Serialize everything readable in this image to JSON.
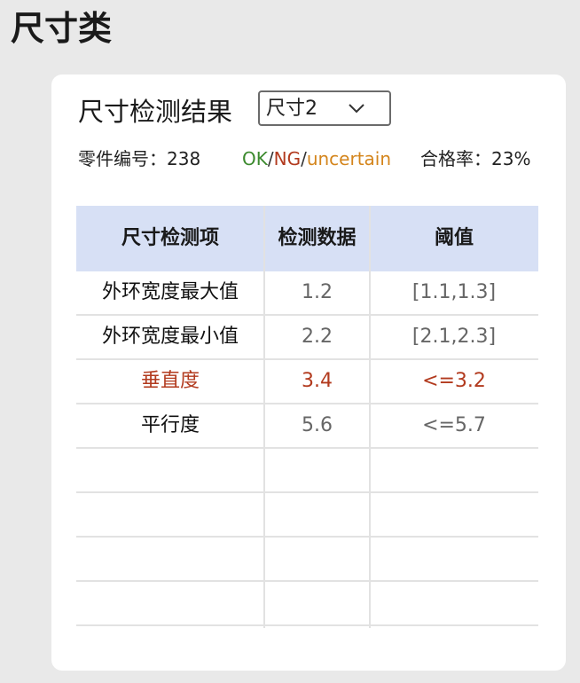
{
  "page": {
    "title": "尺寸类"
  },
  "card": {
    "title": "尺寸检测结果",
    "select": {
      "value": "尺寸2",
      "icon": "chevron-down-icon"
    }
  },
  "info": {
    "part_label": "零件编号：",
    "part_number": "238",
    "legend": {
      "ok": "OK",
      "sep": "/",
      "ng": "NG",
      "uncertain": "uncertain"
    },
    "pass_rate_label": "合格率：",
    "pass_rate": "23%"
  },
  "colors": {
    "ok": "#3c8a2e",
    "ng": "#b23a1e",
    "uncertain": "#d4851c",
    "header_bg": "#d7e0f5"
  },
  "table": {
    "headers": [
      "尺寸检测项",
      "检测数据",
      "阈值"
    ],
    "rows": [
      {
        "item": "外环宽度最大值",
        "data": "1.2",
        "threshold": "[1.1,1.3]",
        "status": "ok"
      },
      {
        "item": "外环宽度最小值",
        "data": "2.2",
        "threshold": "[2.1,2.3]",
        "status": "ok"
      },
      {
        "item": "垂直度",
        "data": "3.4",
        "threshold": "<=3.2",
        "status": "ng"
      },
      {
        "item": "平行度",
        "data": "5.6",
        "threshold": "<=5.7",
        "status": "ok"
      },
      {
        "item": "",
        "data": "",
        "threshold": "",
        "status": ""
      },
      {
        "item": "",
        "data": "",
        "threshold": "",
        "status": ""
      },
      {
        "item": "",
        "data": "",
        "threshold": "",
        "status": ""
      },
      {
        "item": "",
        "data": "",
        "threshold": "",
        "status": ""
      }
    ]
  }
}
